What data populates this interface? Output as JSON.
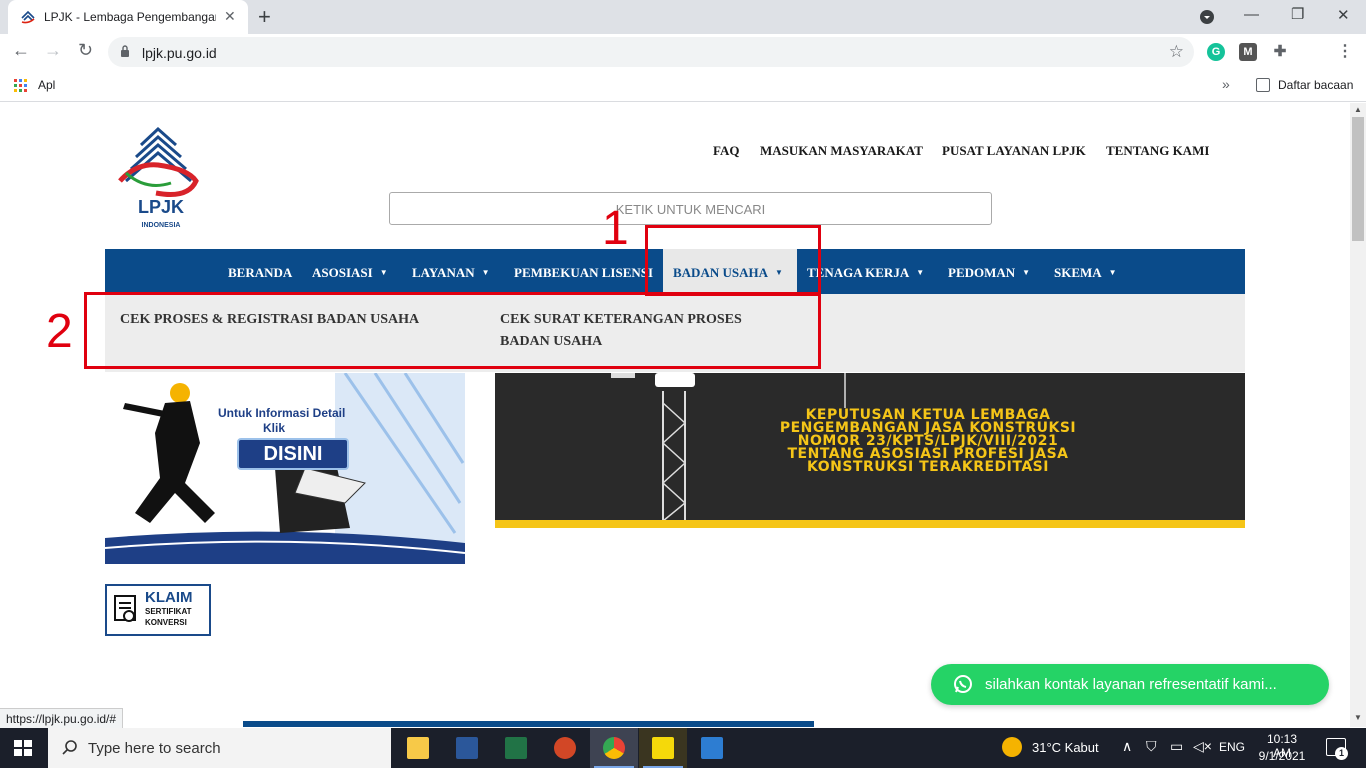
{
  "browser": {
    "tab_title": "LPJK - Lembaga Pengembangan",
    "url": "lpjk.pu.go.id",
    "bookmarks_apps_label": "Apl",
    "reading_list_label": "Daftar bacaan",
    "status_url": "https://lpjk.pu.go.id/#"
  },
  "site": {
    "logo_text": "LPJK",
    "logo_subtext": "INDONESIA",
    "top_nav": [
      "FAQ",
      "MASUKAN MASYARAKAT",
      "PUSAT LAYANAN LPJK",
      "TENTANG KAMI"
    ],
    "search_placeholder": "KETIK UNTUK MENCARI",
    "main_nav": [
      {
        "label": "BERANDA",
        "dropdown": false
      },
      {
        "label": "ASOSIASI",
        "dropdown": true
      },
      {
        "label": "LAYANAN",
        "dropdown": true
      },
      {
        "label": "PEMBEKUAN LISENSI",
        "dropdown": false
      },
      {
        "label": "BADAN USAHA",
        "dropdown": true,
        "active": true
      },
      {
        "label": "TENAGA KERJA",
        "dropdown": true
      },
      {
        "label": "PEDOMAN",
        "dropdown": true
      },
      {
        "label": "SKEMA",
        "dropdown": true
      }
    ],
    "dropdown_items": [
      "CEK PROSES & REGISTRASI BADAN USAHA",
      "CEK SURAT KETERANGAN PROSES BADAN USAHA"
    ],
    "dropdown_item_2_lines": [
      "CEK SURAT KETERANGAN PROSES",
      "BADAN USAHA"
    ],
    "annotation_1": "1",
    "annotation_2": "2",
    "banner_left": {
      "info_line1": "Untuk Informasi Detail",
      "info_line2": "Klik",
      "button": "DISINI"
    },
    "banner_right_lines": [
      "KEPUTUSAN KETUA LEMBAGA",
      "PENGEMBANGAN JASA KONSTRUKSI",
      "NOMOR 23/KPTS/LPJK/VIII/2021",
      "TENTANG ASOSIASI PROFESI JASA",
      "KONSTRUKSI TERAKREDITASI"
    ],
    "klaim": {
      "title": "KLAIM",
      "line1": "SERTIFIKAT",
      "line2": "KONVERSI"
    },
    "whatsapp_label": "silahkan kontak layanan refresentatif kami..."
  },
  "taskbar": {
    "search_placeholder": "Type here to search",
    "weather": "31°C  Kabut",
    "language": "ENG",
    "time": "10:13 AM",
    "date": "9/1/2021",
    "notification_count": "1"
  },
  "colors": {
    "nav_blue": "#0a4b8a",
    "annotation_red": "#e0000f",
    "whatsapp_green": "#25d366",
    "banner_yellow": "#f5c518"
  }
}
